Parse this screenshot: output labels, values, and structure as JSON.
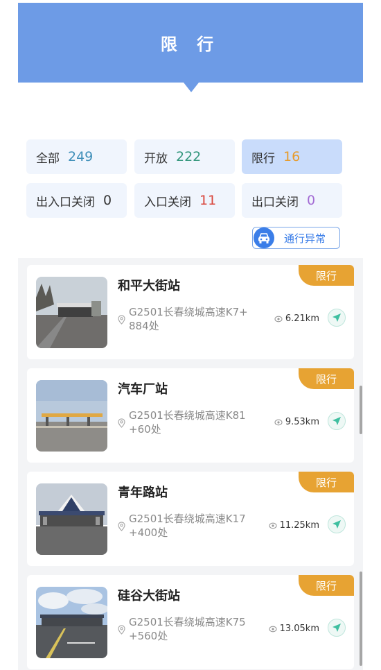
{
  "header": {
    "title": "限 行"
  },
  "filters": [
    {
      "label": "全部",
      "count": "249",
      "color": "#3f8fb9"
    },
    {
      "label": "开放",
      "count": "222",
      "color": "#34977d"
    },
    {
      "label": "限行",
      "count": "16",
      "color": "#e79b2b",
      "active": true
    },
    {
      "label": "出入口关闭",
      "count": "0",
      "color": "#333333"
    },
    {
      "label": "入口关闭",
      "count": "11",
      "color": "#d9453b"
    },
    {
      "label": "出口关闭",
      "count": "0",
      "color": "#a36bd4"
    }
  ],
  "abnormal_button": {
    "label": "通行异常",
    "icon": "car-icon"
  },
  "stations": [
    {
      "name": "和平大街站",
      "address": "G2501长春绕城高速K7+884处",
      "address_line1": "G2501长春绕城高速K7+",
      "address_line2": "884处",
      "distance": "6.21km",
      "tag": "限行"
    },
    {
      "name": "汽车厂站",
      "address": "G2501长春绕城高速K81+60处",
      "address_line1": "G2501长春绕城高速K81",
      "address_line2": "+60处",
      "distance": "9.53km",
      "tag": "限行"
    },
    {
      "name": "青年路站",
      "address": "G2501长春绕城高速K17+400处",
      "address_line1": "G2501长春绕城高速K17",
      "address_line2": "+400处",
      "distance": "11.25km",
      "tag": "限行"
    },
    {
      "name": "硅谷大街站",
      "address": "G2501长春绕城高速K75+560处",
      "address_line1": "G2501长春绕城高速K75",
      "address_line2": "+560处",
      "distance": "13.05km",
      "tag": "限行"
    }
  ],
  "colors": {
    "header": "#6d9be6",
    "accent": "#3b7ee8",
    "tag": "#e7a333",
    "nav": "#3fbfa0"
  }
}
